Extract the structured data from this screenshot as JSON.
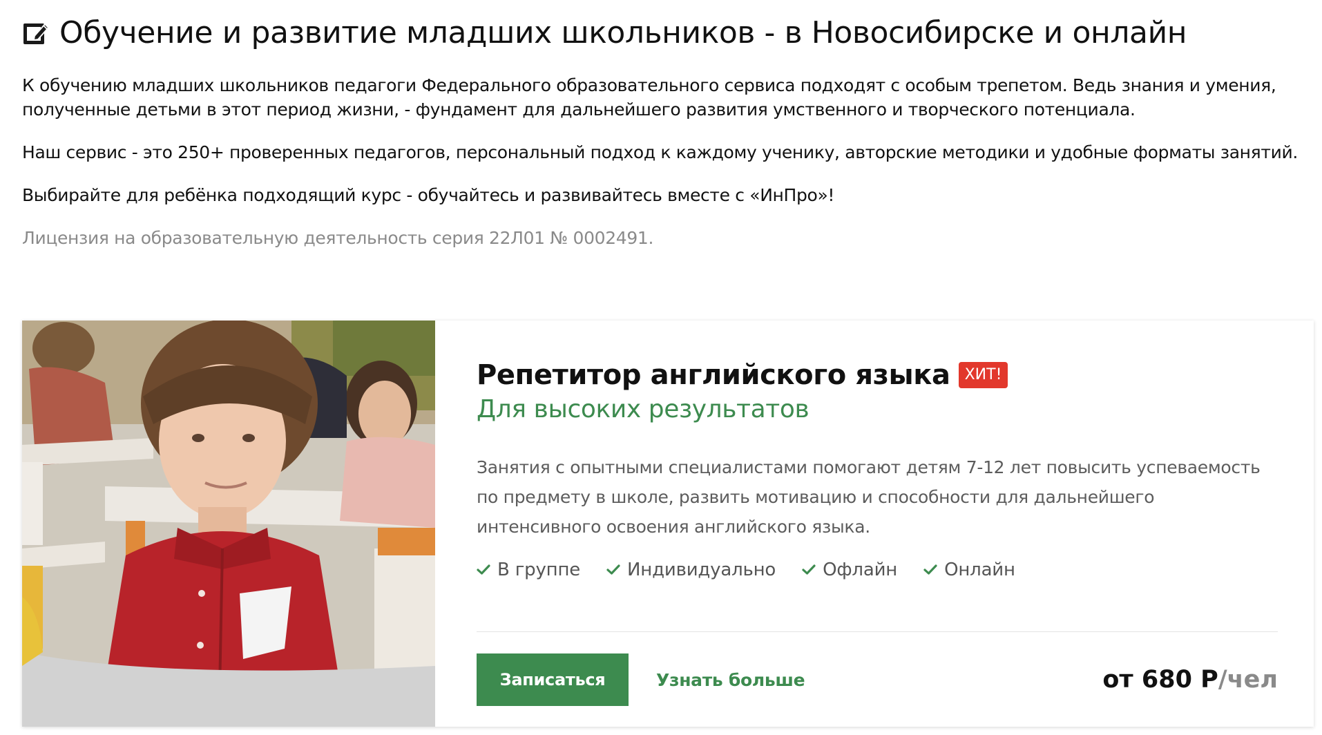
{
  "header": {
    "title": "Обучение и развитие младших школьников - в Новосибирске и онлайн",
    "icon": "edit-note-icon"
  },
  "intro": {
    "paragraph_1": "К обучению младших школьников педагоги Федерального образовательного сервиса подходят с особым трепетом. Ведь знания и умения, полученные детьми в этот период жизни, - фундамент для дальнейшего развития умственного и творческого потенциала.",
    "paragraph_2": "Наш сервис - это 250+ проверенных педагогов, персональный подход к каждому ученику, авторские методики и удобные форматы занятий.",
    "paragraph_3": "Выбирайте для ребёнка подходящий курс - обучайтесь и развивайтесь вместе с «ИнПро»!",
    "license": "Лицензия на образовательную деятельность серия 22Л01 № 0002491."
  },
  "course": {
    "image": "photo-boy-in-red-shirt-classroom",
    "title": "Репетитор английского языка",
    "badge": "ХИТ!",
    "subtitle": "Для высоких результатов",
    "description": "Занятия с опытными специалистами помогают детям 7-12 лет повысить успеваемость по предмету в школе, развить мотивацию и способности для дальнейшего интенсивного освоения английского языка.",
    "formats": [
      "В группе",
      "Индивидуально",
      "Офлайн",
      "Онлайн"
    ],
    "enroll_label": "Записаться",
    "more_label": "Узнать больше",
    "price_amount": "от 680 Р",
    "price_unit": "/чел"
  },
  "colors": {
    "accent_green": "#3d8b4f",
    "badge_red": "#e2382c",
    "muted_text": "#8a8a8a"
  }
}
